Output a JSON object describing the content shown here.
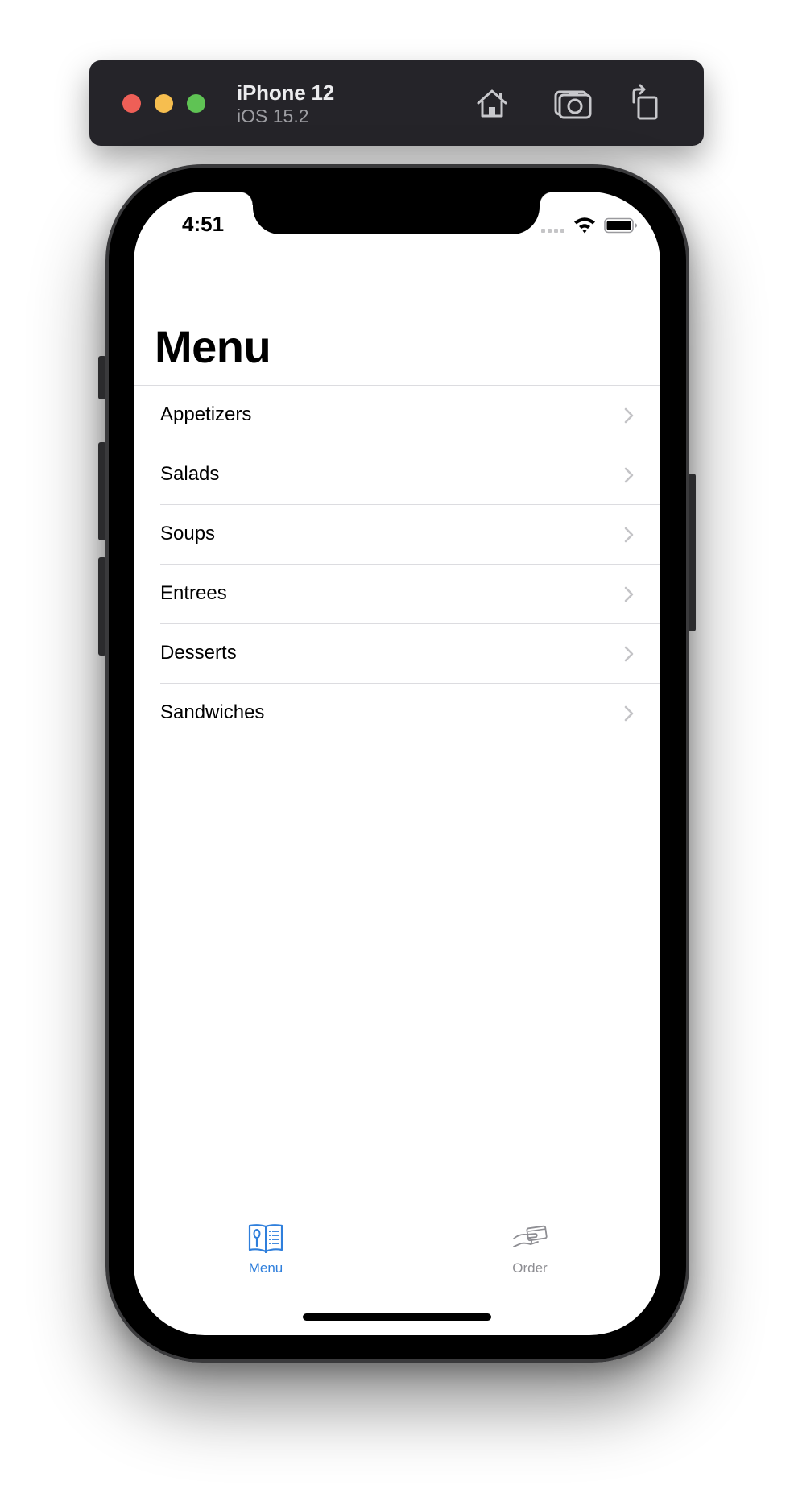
{
  "simulator": {
    "device_name": "iPhone 12",
    "os_version": "iOS 15.2",
    "buttons": {
      "home_icon": "home-icon",
      "screenshot_icon": "camera-icon",
      "rotate_icon": "rotate-icon"
    }
  },
  "status_bar": {
    "time": "4:51",
    "wifi_icon": "wifi-icon",
    "battery_icon": "battery-icon"
  },
  "screen": {
    "title": "Menu",
    "categories": [
      {
        "label": "Appetizers"
      },
      {
        "label": "Salads"
      },
      {
        "label": "Soups"
      },
      {
        "label": "Entrees"
      },
      {
        "label": "Desserts"
      },
      {
        "label": "Sandwiches"
      }
    ]
  },
  "tab_bar": {
    "tabs": [
      {
        "label": "Menu",
        "icon": "menu-book-icon",
        "selected": true
      },
      {
        "label": "Order",
        "icon": "order-hand-card-icon",
        "selected": false
      }
    ]
  },
  "colors": {
    "accent": "#2f7fdc",
    "inactive": "#8e8e93",
    "toolbar_bg": "#252429"
  }
}
